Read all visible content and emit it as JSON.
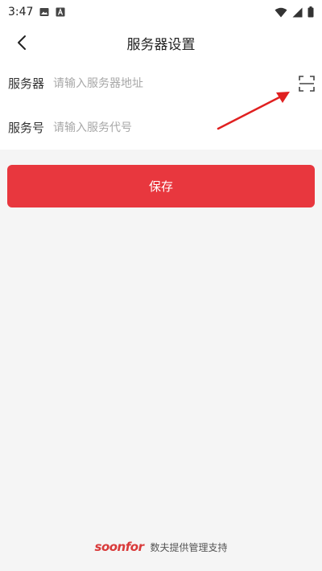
{
  "status_bar": {
    "time": "3:47",
    "icons": [
      "image-icon",
      "a-box-icon",
      "wifi-icon",
      "signal-icon",
      "battery-icon"
    ]
  },
  "header": {
    "title": "服务器设置",
    "back_icon": "chevron-left-icon"
  },
  "form": {
    "server": {
      "label": "服务器",
      "placeholder": "请输入服务器地址",
      "value": ""
    },
    "service_code": {
      "label": "服务号",
      "placeholder": "请输入服务代号",
      "value": ""
    },
    "scan_icon": "scan-icon"
  },
  "actions": {
    "save_label": "保存"
  },
  "footer": {
    "brand": "soonfor",
    "text": "数夫提供管理支持"
  },
  "colors": {
    "accent": "#e8373e",
    "background": "#f5f5f5",
    "surface": "#ffffff",
    "placeholder": "#a8a8a8",
    "annotation": "#e02020"
  }
}
